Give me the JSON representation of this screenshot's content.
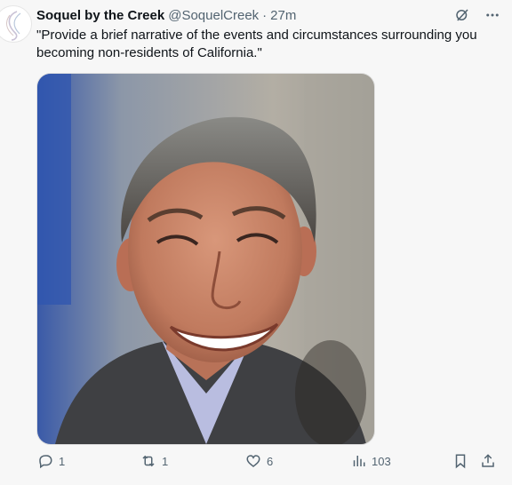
{
  "tweet": {
    "author_name": "Soquel by the Creek",
    "handle": "@SoquelCreek",
    "separator": "·",
    "time": "27m",
    "text": "\"Provide a brief narrative of the events and circumstances surrounding you becoming non-residents of California.\"",
    "media": {
      "description": "photo",
      "alt": ""
    }
  },
  "actions": {
    "reply_count": "1",
    "retweet_count": "1",
    "like_count": "6",
    "views_count": "103"
  },
  "icons": {
    "grok": "grok-icon",
    "more": "more-icon",
    "reply": "reply-icon",
    "retweet": "retweet-icon",
    "like": "like-icon",
    "views": "views-icon",
    "bookmark": "bookmark-icon",
    "share": "share-icon"
  },
  "colors": {
    "text": "#0f1419",
    "muted": "#536471",
    "background": "#f7f7f7"
  }
}
